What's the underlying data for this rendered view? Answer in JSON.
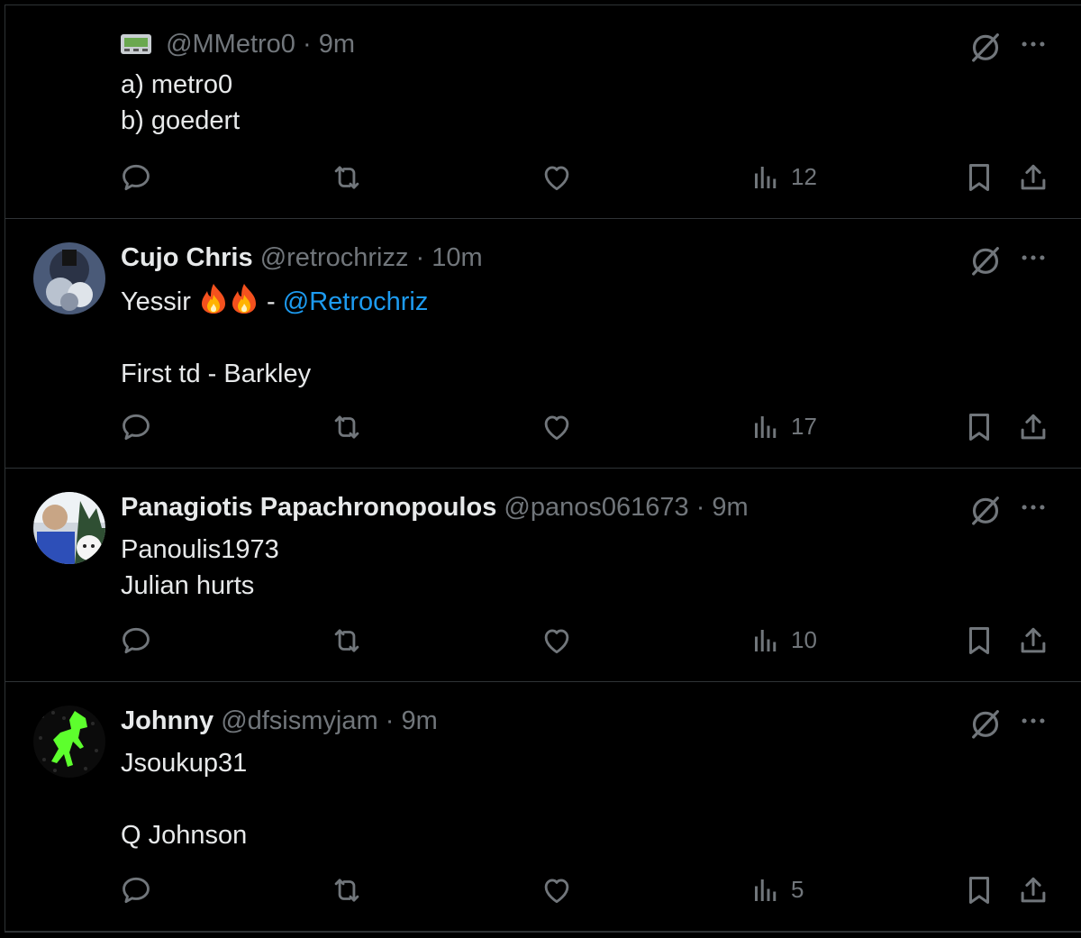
{
  "posts": [
    {
      "name": "",
      "handle": "@MMetro0",
      "dot": "·",
      "time": "9m",
      "lines": [
        "a) metro0",
        "b) goedert"
      ],
      "views": "12"
    },
    {
      "name": "Cujo Chris",
      "handle": "@retrochrizz",
      "dot": "·",
      "time": "10m",
      "line1_text": "Yessir",
      "line1_sep": " - ",
      "line1_mention": "@Retrochriz",
      "lines": [
        "",
        "First td - Barkley"
      ],
      "views": "17"
    },
    {
      "name": "Panagiotis Papachronopoulos",
      "handle": "@panos061673",
      "dot": "·",
      "time": "9m",
      "lines": [
        "Panoulis1973",
        "Julian hurts"
      ],
      "views": "10"
    },
    {
      "name": "Johnny",
      "handle": "@dfsismyjam",
      "dot": "·",
      "time": "9m",
      "lines": [
        "Jsoukup31",
        "",
        "Q Johnson"
      ],
      "views": "5"
    }
  ],
  "icons": {
    "reply": "reply-icon",
    "repost": "repost-icon",
    "like": "like-icon",
    "views": "views-icon",
    "bookmark": "bookmark-icon",
    "share": "share-icon",
    "grok": "grok-icon",
    "more": "more-icon"
  },
  "colors": {
    "background": "#000000",
    "text": "#e7e9ea",
    "muted": "#71767b",
    "link": "#1d9bf0",
    "divider": "#2f3336"
  }
}
